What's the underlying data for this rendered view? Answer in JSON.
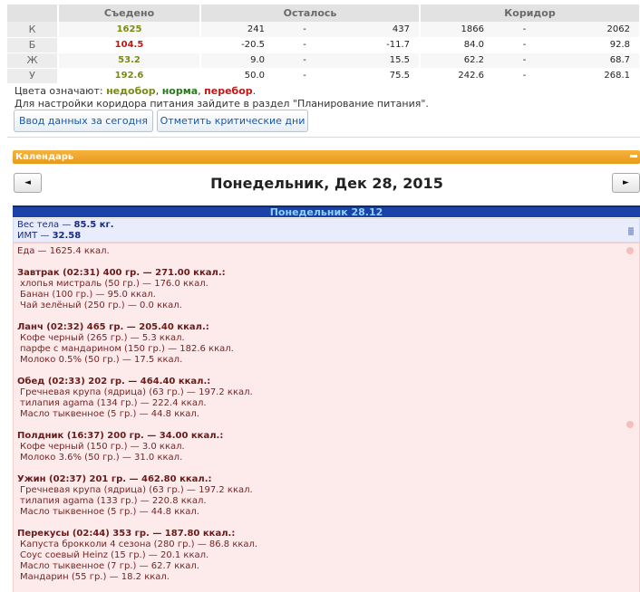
{
  "summary": {
    "headers": [
      "Съедено",
      "Осталось",
      "Коридор"
    ],
    "rows": [
      {
        "letter": "К",
        "eaten": "1625",
        "eaten_status": "under",
        "left_lo": "241",
        "left_hi": "437",
        "corr_lo": "1866",
        "corr_hi": "2062"
      },
      {
        "letter": "Б",
        "eaten": "104.5",
        "eaten_status": "over",
        "left_lo": "-20.5",
        "left_hi": "-11.7",
        "corr_lo": "84.0",
        "corr_hi": "92.8"
      },
      {
        "letter": "Ж",
        "eaten": "53.2",
        "eaten_status": "under",
        "left_lo": "9.0",
        "left_hi": "15.5",
        "corr_lo": "62.2",
        "corr_hi": "68.7"
      },
      {
        "letter": "У",
        "eaten": "192.6",
        "eaten_status": "under",
        "left_lo": "50.0",
        "left_hi": "75.5",
        "corr_lo": "242.6",
        "corr_hi": "268.1"
      }
    ],
    "dash": "-"
  },
  "legend": {
    "prefix": "Цвета означают: ",
    "under": "недобор",
    "sep1": ", ",
    "norm": "норма",
    "sep2": ", ",
    "over": "перебор",
    "suffix": "."
  },
  "hint": "Для настройки коридора питания зайдите в раздел \"Планирование питания\".",
  "buttons": {
    "enter_today": "Ввод данных за сегодня",
    "mark_critical": "Отметить критические дни"
  },
  "colors": {
    "under": "#7a8a17",
    "norm": "#257a1c",
    "over": "#c01818",
    "calendar_header": "#e8991b",
    "day_bar": "#1a42a8"
  },
  "calendar": {
    "header": "Календарь",
    "date_title": "Понедельник, Дек 28, 2015",
    "prev_icon": "arrow-left-icon",
    "next_icon": "arrow-right-icon",
    "prev_glyph": "◄",
    "next_glyph": "►",
    "day_label": "Понедельник 28.12"
  },
  "body": {
    "weight_label": "Вес тела — ",
    "weight_value": "85.5 кг.",
    "bmi_label": "ИМТ — ",
    "bmi_value": "32.58"
  },
  "food": {
    "total": "Еда — 1625.4 ккал.",
    "meals": [
      {
        "title": "Завтрак (02:31) 400 гр. — 271.00 ккал.:",
        "items": [
          "хлопья мистраль (50 гр.) — 176.0 ккал.",
          "Банан (100 гр.) — 95.0 ккал.",
          "Чай зелёный (250 гр.) — 0.0 ккал."
        ]
      },
      {
        "title": "Ланч (02:32) 465 гр. — 205.40 ккал.:",
        "items": [
          "Кофе черный (265 гр.) — 5.3 ккал.",
          "парфе с мандарином (150 гр.) — 182.6 ккал.",
          "Молоко 0.5% (50 гр.) — 17.5 ккал."
        ]
      },
      {
        "title": "Обед (02:33) 202 гр. — 464.40 ккал.:",
        "items": [
          "Гречневая крупа (ядрица) (63 гр.) — 197.2 ккал.",
          "тилапия agama (134 гр.) — 222.4 ккал.",
          "Масло тыквенное (5 гр.) — 44.8 ккал."
        ]
      },
      {
        "title": "Полдник (16:37) 200 гр. — 34.00 ккал.:",
        "items": [
          "Кофе черный (150 гр.) — 3.0 ккал.",
          "Молоко 3.6% (50 гр.) — 31.0 ккал."
        ]
      },
      {
        "title": "Ужин (02:37) 201 гр. — 462.80 ккал.:",
        "items": [
          "Гречневая крупа (ядрица) (63 гр.) — 197.2 ккал.",
          "тилапия agama (133 гр.) — 220.8 ккал.",
          "Масло тыквенное (5 гр.) — 44.8 ккал."
        ]
      },
      {
        "title": "Перекусы (02:44) 353 гр. — 187.80 ккал.:",
        "items": [
          "Капуста брокколи 4 сезона (280 гр.) — 86.8 ккал.",
          "Соус соевый Heinz (15 гр.) — 20.1 ккал.",
          "Масло тыквенное (7 гр.) — 62.7 ккал.",
          "Мандарин (55 гр.) — 18.2 ккал."
        ]
      }
    ]
  }
}
